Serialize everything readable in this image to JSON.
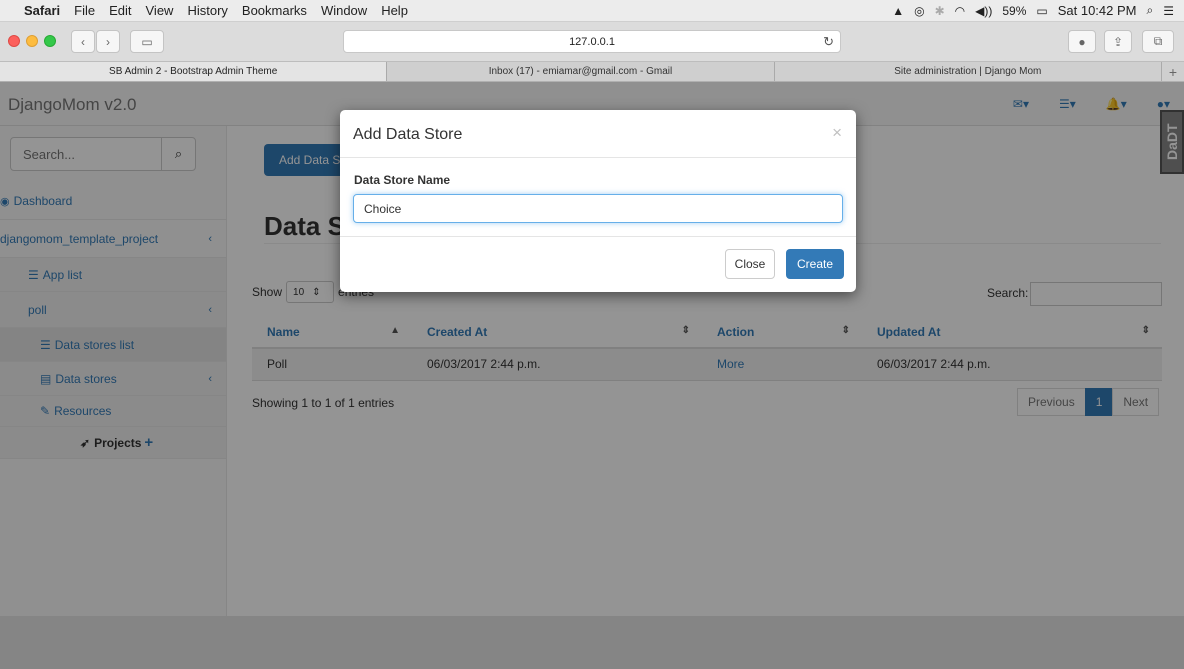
{
  "menubar": {
    "app": "Safari",
    "items": [
      "File",
      "Edit",
      "View",
      "History",
      "Bookmarks",
      "Window",
      "Help"
    ],
    "battery": "59%",
    "clock": "Sat 10:42 PM"
  },
  "browser": {
    "url": "127.0.0.1",
    "tabs": [
      "SB Admin 2 - Bootstrap Admin Theme",
      "Inbox (17) - emiamar@gmail.com - Gmail",
      "Site administration | Django Mom"
    ]
  },
  "navbar": {
    "brand": "DjangoMom v2.0"
  },
  "sidebar": {
    "search_placeholder": "Search...",
    "items": [
      {
        "label": "Dashboard",
        "icon": "dashboard-icon"
      },
      {
        "label": "djangomom_template_project"
      },
      {
        "label": "App list",
        "icon": "list-icon"
      },
      {
        "label": "poll"
      },
      {
        "label": "Data stores list",
        "icon": "list-icon"
      },
      {
        "label": "Data stores",
        "icon": "database-icon"
      },
      {
        "label": "Resources",
        "icon": "wrench-icon"
      },
      {
        "label": "Projects",
        "icon": "rocket-icon"
      }
    ]
  },
  "main": {
    "add_button": "Add Data Store",
    "heading": "Data Stores",
    "show_label": "Show",
    "show_value": "10",
    "entries_label": "entries",
    "search_label": "Search:",
    "columns": [
      "Name",
      "Created At",
      "Action",
      "Updated At"
    ],
    "rows": [
      {
        "name": "Poll",
        "created": "06/03/2017 2:44 p.m.",
        "action": "More",
        "updated": "06/03/2017 2:44 p.m."
      }
    ],
    "showing": "Showing 1 to 1 of 1 entries",
    "pager": {
      "prev": "Previous",
      "page": "1",
      "next": "Next"
    }
  },
  "badge": "DaDT",
  "modal": {
    "title": "Add Data Store",
    "close_symbol": "×",
    "field_label": "Data Store Name",
    "field_value": "Choice",
    "close_button": "Close",
    "create_button": "Create"
  },
  "colors": {
    "primary": "#337ab7",
    "focus": "#66afe9"
  }
}
